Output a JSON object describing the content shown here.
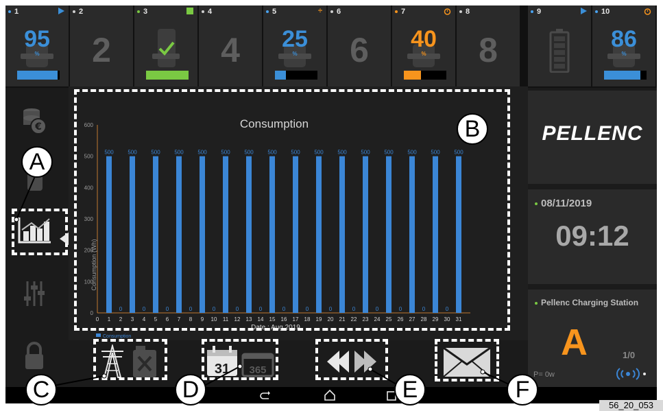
{
  "slots": [
    {
      "num": "1",
      "dot": "#4aa3f0",
      "status": "play",
      "kind": "percent",
      "value": "95",
      "color": "#3b8fd8",
      "bar_level": 0.95
    },
    {
      "num": "2",
      "dot": "#cfcfcf",
      "kind": "empty",
      "value": "2"
    },
    {
      "num": "3",
      "dot": "#7ac943",
      "status": "square",
      "kind": "check",
      "bar_level": 1.0
    },
    {
      "num": "4",
      "dot": "#cfcfcf",
      "kind": "empty",
      "value": "4"
    },
    {
      "num": "5",
      "dot": "#4aa3f0",
      "status": "divide",
      "kind": "percent",
      "value": "25",
      "color": "#3b8fd8",
      "bar_level": 0.25
    },
    {
      "num": "6",
      "dot": "#cfcfcf",
      "kind": "empty",
      "value": "6"
    },
    {
      "num": "7",
      "dot": "#f7941d",
      "status": "alarm",
      "kind": "percent",
      "value": "40",
      "color": "#f7941d",
      "bar_level": 0.4
    },
    {
      "num": "8",
      "dot": "#cfcfcf",
      "kind": "empty",
      "value": "8"
    },
    {
      "num": "9",
      "dot": "#4aa3f0",
      "status": "play",
      "kind": "battery"
    },
    {
      "num": "10",
      "dot": "#4aa3f0",
      "status": "alarm",
      "kind": "percent",
      "value": "86",
      "color": "#3b8fd8",
      "bar_level": 0.86
    }
  ],
  "percent_sign": "%",
  "sidebar": [
    "coins-icon",
    "battery-icon",
    "chart-icon",
    "sliders-icon",
    "lock-icon"
  ],
  "brand": {
    "logo": "PELLENC"
  },
  "datetime": {
    "date": "08/11/2019",
    "time": "09:12"
  },
  "station": {
    "title": "Pellenc Charging Station",
    "letter": "A",
    "count": "1/0",
    "power": "P= 0w"
  },
  "actions": [
    "power-pylon-icon",
    "calendar-icon",
    "rewind-forward-icon",
    "envelope-icon"
  ],
  "calendar": {
    "day": "31",
    "year": "365"
  },
  "callouts": [
    "A",
    "B",
    "C",
    "D",
    "E",
    "F"
  ],
  "reference": "56_20_053",
  "chart_data": {
    "type": "bar",
    "title": "Consumption",
    "xlabel": "Date : Aug 2019",
    "ylabel": "Consumption (Wh)",
    "ylim": [
      0,
      600
    ],
    "yticks": [
      0,
      100,
      200,
      300,
      400,
      500,
      600
    ],
    "x": [
      0,
      1,
      2,
      3,
      4,
      5,
      6,
      7,
      8,
      9,
      10,
      11,
      12,
      13,
      14,
      15,
      16,
      17,
      18,
      19,
      20,
      21,
      22,
      23,
      24,
      25,
      26,
      27,
      28,
      29,
      30,
      31
    ],
    "series": [
      {
        "name": "Consumption",
        "x": [
          1,
          2,
          3,
          4,
          5,
          6,
          7,
          8,
          9,
          10,
          11,
          12,
          13,
          14,
          15,
          16,
          17,
          18,
          19,
          20,
          21,
          22,
          23,
          24,
          25,
          26,
          27,
          28,
          29,
          30,
          31
        ],
        "values": [
          500,
          0,
          500,
          0,
          500,
          0,
          500,
          0,
          500,
          0,
          500,
          0,
          500,
          0,
          500,
          0,
          500,
          0,
          500,
          0,
          500,
          0,
          500,
          0,
          500,
          0,
          500,
          0,
          500,
          0,
          500
        ],
        "color": "#3b86d6"
      }
    ],
    "legend": "bottom-left",
    "grid": false
  }
}
